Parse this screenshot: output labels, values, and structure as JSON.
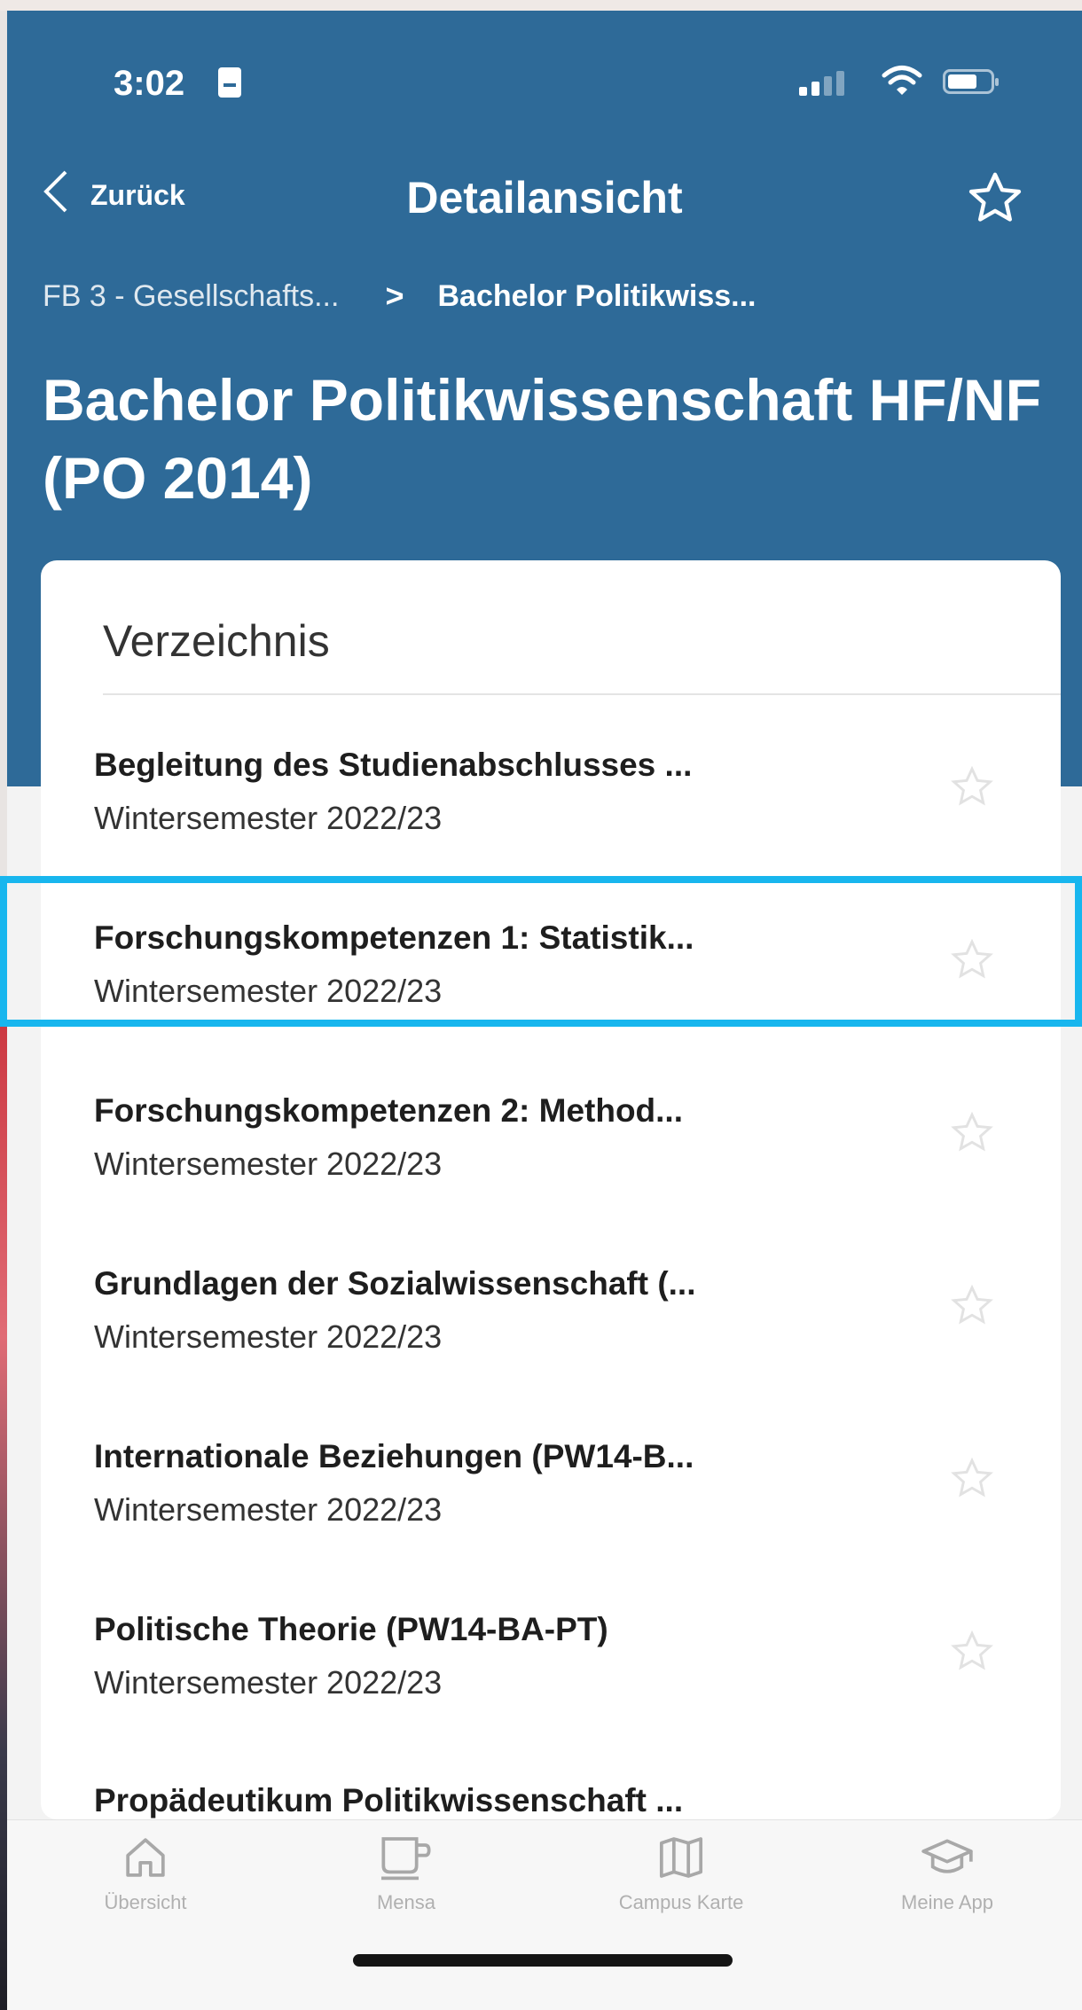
{
  "status_bar": {
    "time": "3:02"
  },
  "nav": {
    "back_label": "Zurück",
    "title": "Detailansicht",
    "favorite_icon": "star-outline-icon"
  },
  "breadcrumb": {
    "parent": "FB 3 - Gesellschafts...",
    "separator": ">",
    "current": "Bachelor Politikwiss..."
  },
  "page": {
    "title": "Bachelor Politikwissenschaft HF/NF (PO 2014)"
  },
  "directory": {
    "title": "Verzeichnis",
    "items": [
      {
        "title": "Begleitung des Studienabschlusses ...",
        "subtitle": "Wintersemester 2022/23"
      },
      {
        "title": "Forschungskompetenzen 1: Statistik...",
        "subtitle": "Wintersemester 2022/23"
      },
      {
        "title": "Forschungskompetenzen 2: Method...",
        "subtitle": "Wintersemester 2022/23"
      },
      {
        "title": "Grundlagen der Sozialwissenschaft (...",
        "subtitle": "Wintersemester 2022/23"
      },
      {
        "title": "Internationale Beziehungen (PW14-B...",
        "subtitle": "Wintersemester 2022/23"
      },
      {
        "title": "Politische Theorie (PW14-BA-PT)",
        "subtitle": "Wintersemester 2022/23"
      },
      {
        "title": "Propädeutikum Politikwissenschaft ...",
        "subtitle": ""
      }
    ]
  },
  "tabbar": {
    "tabs": [
      {
        "label": "Übersicht",
        "icon": "home-icon"
      },
      {
        "label": "Mensa",
        "icon": "coffee-cup-icon"
      },
      {
        "label": "Campus Karte",
        "icon": "map-icon"
      },
      {
        "label": "Meine App",
        "icon": "graduation-cap-icon"
      }
    ]
  },
  "colors": {
    "header": "#2e6a98",
    "highlight": "#18b6ee",
    "card": "#ffffff"
  }
}
